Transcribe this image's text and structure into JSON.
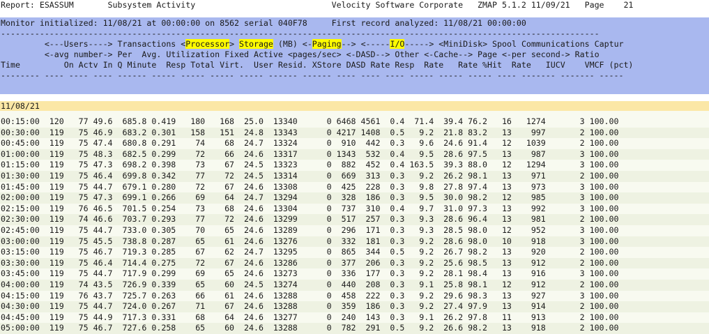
{
  "report_header": "Report: ESASSUM       Subsystem Activity                            Velocity Software Corporate   ZMAP 5.1.2 11/09/21   Page    21",
  "init_line": "Monitor initialized: 11/08/21 at 00:00:00 on 8562 serial 040F78     First record analyzed: 11/08/21 00:00:00",
  "dash_line": "---------------------------------------------------------------------------------------------------------------------------",
  "header_lines": [
    {
      "pre": "         <---Users----> Transactions <",
      "hl": "Processor",
      "mid": "> ",
      "hl2": "Storage",
      "post": " (MB) <-",
      "hl3": "Paging",
      "post2": "--> <-----",
      "hl4": "I/O",
      "post3": "-----> <MiniDisk> Spool Communications Captur"
    },
    {
      "text": "         <-avg number-> Per  Avg. Utilization Fixed Active <pages/sec> <-DASD--> Other <-Cache--> Page <-per second-> Ratio"
    },
    {
      "text": "Time         On Actv In Q Minute  Resp Total Virt.  User Resid. XStore DASD Rate Resp  Rate   Rate %Hit  Rate   IUCV    VMCF (pct)"
    },
    {
      "text": "-------- ---- ---- ---- ------ ----- ----- ----- ----- ------ ------ ---- ---- ---- ----- ----- ----- ---- ------- ------- -----"
    }
  ],
  "date_row": "11/08/21",
  "rows": [
    "00:15:00  120   77 49.6  685.8 0.419   180   168  25.0  13340      0 6468 4561  0.4  71.4  39.4 76.2   16   1274       3 100.00",
    "00:30:00  119   75 46.9  683.2 0.301   158   151  24.8  13343      0 4217 1408  0.5   9.2  21.8 83.2   13    997       2 100.00",
    "00:45:00  119   75 47.4  680.8 0.291    74    68  24.7  13324      0  910  442  0.3   9.6  24.6 91.4   12   1039       2 100.00",
    "01:00:00  119   75 48.3  682.5 0.299    72    66  24.6  13317      0 1343  532  0.4   9.5  28.6 97.5   13    987       3 100.00",
    "01:15:00  119   75 47.3  698.2 0.398    73    67  24.5  13323      0  882  452  0.4 163.5  39.3 88.0   12   1294       3 100.00",
    "01:30:00  119   75 46.4  699.8 0.342    77    72  24.5  13314      0  669  313  0.3   9.2  26.2 98.1   13    971       2 100.00",
    "01:45:00  119   75 44.7  679.1 0.280    72    67  24.6  13308      0  425  228  0.3   9.8  27.8 97.4   13    973       3 100.00",
    "02:00:00  119   75 47.3  699.1 0.266    69    64  24.7  13294      0  328  186  0.3   9.5  30.0 98.2   12    985       3 100.00",
    "02:15:00  119   76 46.5  701.5 0.254    73    68  24.6  13304      0  737  310  0.4   9.7  31.0 97.3   13    992       3 100.00",
    "02:30:00  119   74 46.6  703.7 0.293    77    72  24.6  13299      0  517  257  0.3   9.3  28.6 96.4   13    981       2 100.00",
    "02:45:00  119   75 44.7  733.0 0.305    70    65  24.6  13289      0  296  171  0.3   9.3  28.5 98.0   12    952       3 100.00",
    "03:00:00  119   75 45.5  738.8 0.287    65    61  24.6  13276      0  332  181  0.3   9.2  28.6 98.0   10    918       3 100.00",
    "03:15:00  119   75 46.7  719.3 0.285    67    62  24.7  13295      0  865  344  0.5   9.2  26.7 98.2   13    920       2 100.00",
    "03:30:00  119   75 46.4  714.4 0.275    72    67  24.6  13286      0  377  206  0.3   9.2  25.6 98.5   13    912       2 100.00",
    "03:45:00  119   75 44.7  717.9 0.299    69    65  24.6  13273      0  336  177  0.3   9.2  28.1 98.4   13    916       3 100.00",
    "04:00:00  119   74 43.5  726.9 0.339    65    60  24.5  13274      0  440  208  0.3   9.1  25.8 98.1   12    912       2 100.00",
    "04:15:00  119   76 43.7  725.7 0.263    66    61  24.6  13288      0  458  222  0.3   9.2  29.6 98.3   13    927       3 100.00",
    "04:30:00  119   75 44.7  724.0 0.267    71    67  24.6  13288      0  359  186  0.3   9.2  27.4 97.9   13    914       2 100.00",
    "04:45:00  119   75 44.9  717.3 0.331    68    64  24.6  13277      0  240  143  0.3   9.1  26.2 97.8   11    913       2 100.00",
    "05:00:00  119   75 46.7  727.6 0.258    65    60  24.6  13288      0  782  291  0.5   9.2  26.6 98.2   13    918       2 100.00"
  ],
  "colors": {
    "header_band": "#a9b8ef",
    "highlight": "#fffc00",
    "date_band": "#fbe7a6",
    "row_bg": "#f8faf0",
    "row_alt": "#eef2e2"
  }
}
